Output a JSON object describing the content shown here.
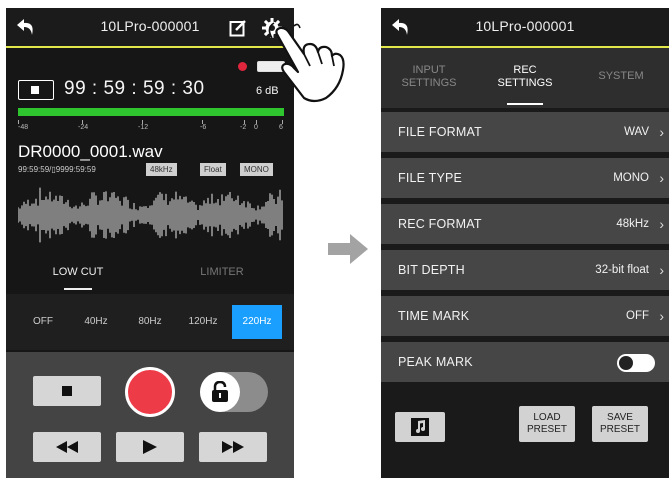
{
  "left": {
    "title": "10LPro-000001",
    "timecode": "99 : 59 : 59 : 30",
    "gain": "6 dB",
    "meter_scale": [
      "-48",
      "-24",
      "-12",
      "-6",
      "-2",
      "0",
      "6"
    ],
    "filename": "DR0000_0001.wav",
    "fileinfo": "99:59:59/▯9999:59:59",
    "tags": [
      "48kHz",
      "Float",
      "MONO"
    ],
    "tabs": {
      "lowcut": "LOW CUT",
      "limiter": "LIMITER"
    },
    "freqs": [
      "OFF",
      "40Hz",
      "80Hz",
      "120Hz",
      "220Hz"
    ],
    "freq_selected": "220Hz",
    "lock_state": "unlocked",
    "accent_color": "#1a9fff",
    "meter_color": "#2ec52e",
    "rec_color": "#ee3b48"
  },
  "right": {
    "title": "10LPro-000001",
    "tabs": [
      {
        "label": "INPUT\nSETTINGS",
        "active": false
      },
      {
        "label": "REC\nSETTINGS",
        "active": true
      },
      {
        "label": "SYSTEM",
        "active": false
      }
    ],
    "rows": [
      {
        "label": "FILE FORMAT",
        "value": "WAV"
      },
      {
        "label": "FILE TYPE",
        "value": "MONO"
      },
      {
        "label": "REC FORMAT",
        "value": "48kHz"
      },
      {
        "label": "BIT DEPTH",
        "value": "32-bit float"
      },
      {
        "label": "TIME MARK",
        "value": "OFF"
      },
      {
        "label": "PEAK MARK",
        "value": "",
        "toggle": false
      }
    ],
    "buttons": {
      "load": "LOAD\nPRESET",
      "save": "SAVE\nPRESET"
    },
    "music_icon": "music-note-icon"
  }
}
